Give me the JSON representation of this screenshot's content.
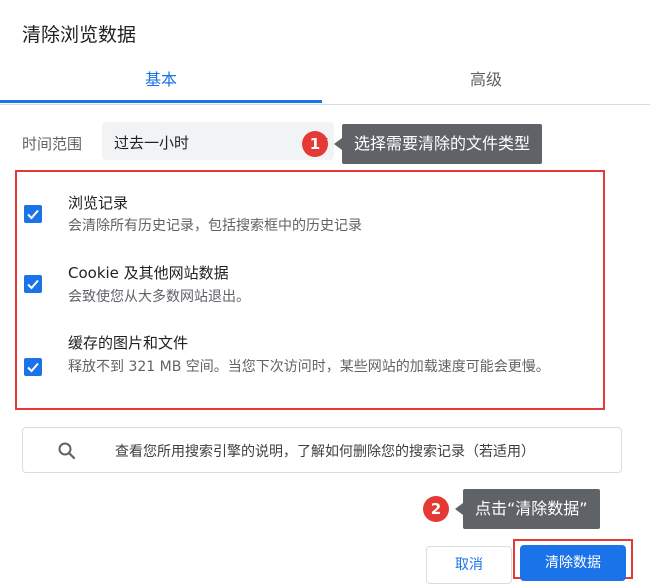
{
  "dialog": {
    "title": "清除浏览数据"
  },
  "tabs": [
    {
      "label": "基本",
      "active": true
    },
    {
      "label": "高级",
      "active": false
    }
  ],
  "time_range": {
    "label": "时间范围",
    "value": "过去一小时"
  },
  "annotations": [
    {
      "number": "1",
      "text": "选择需要清除的文件类型"
    },
    {
      "number": "2",
      "text": "点击“清除数据”"
    }
  ],
  "options": [
    {
      "title": "浏览记录",
      "description": "会清除所有历史记录，包括搜索框中的历史记录",
      "checked": true
    },
    {
      "title": "Cookie 及其他网站数据",
      "description": "会致使您从大多数网站退出。",
      "checked": true
    },
    {
      "title": "缓存的图片和文件",
      "description": "释放不到 321 MB 空间。当您下次访问时，某些网站的加载速度可能会更慢。",
      "checked": true
    }
  ],
  "search_info": {
    "text": "查看您所用搜索引擎的说明，了解如何删除您的搜索记录（若适用）"
  },
  "buttons": {
    "cancel": "取消",
    "clear": "清除数据"
  },
  "colors": {
    "accent": "#1a73e8",
    "highlight": "#e53935",
    "callout_bg": "#5f6368"
  }
}
